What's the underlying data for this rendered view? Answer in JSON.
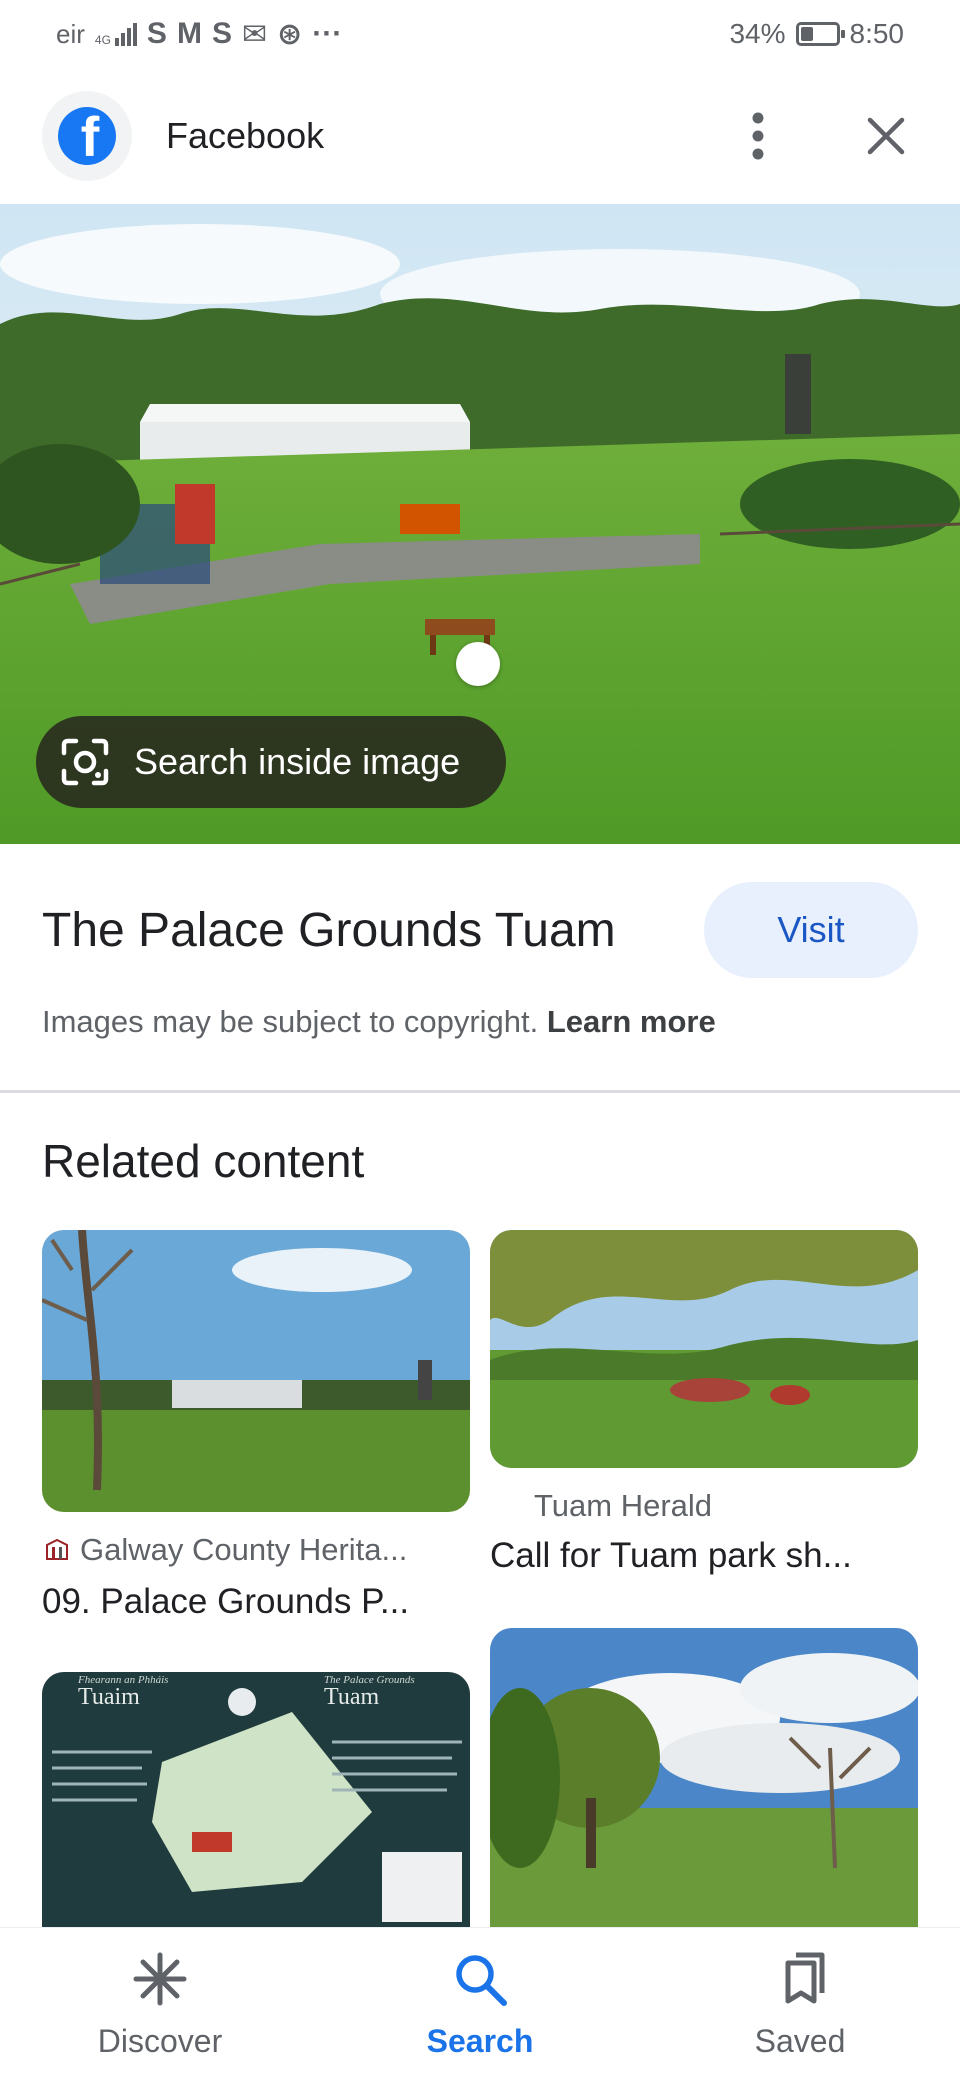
{
  "status_bar": {
    "carrier": "eir",
    "network": "4G",
    "notification_icons": [
      "S",
      "M",
      "S",
      "✉",
      "⊛",
      "···"
    ],
    "battery_percent": "34%",
    "battery_level": 0.34,
    "time": "8:50"
  },
  "appbar": {
    "logo_letter": "f",
    "title": "Facebook",
    "more_icon": "more-vert-icon",
    "close_icon": "close-icon"
  },
  "hero": {
    "search_inside_label": "Search inside image"
  },
  "result": {
    "title": "The Palace Grounds Tuam",
    "visit_label": "Visit",
    "copyright_text": "Images may be subject to copyright.",
    "learn_more_label": "Learn more"
  },
  "related": {
    "heading": "Related content",
    "items": [
      {
        "source": "Galway County Herita...",
        "caption": "09. Palace Grounds P..."
      },
      {
        "source": "Tuam Herald",
        "caption": "Call for Tuam park sh..."
      },
      {
        "map_title_left": "Fhearann an Phháis",
        "map_name_left": "Tuaim",
        "map_title_right": "The Palace Grounds",
        "map_name_right": "Tuam"
      },
      {}
    ]
  },
  "bottom_nav": {
    "items": [
      {
        "label": "Discover",
        "icon": "asterisk-icon",
        "active": false
      },
      {
        "label": "Search",
        "icon": "search-icon",
        "active": true
      },
      {
        "label": "Saved",
        "icon": "bookmarks-icon",
        "active": false
      }
    ]
  },
  "colors": {
    "accent": "#1a73e8",
    "visit_bg": "#e8f0fe",
    "facebook_blue": "#1877f2"
  }
}
